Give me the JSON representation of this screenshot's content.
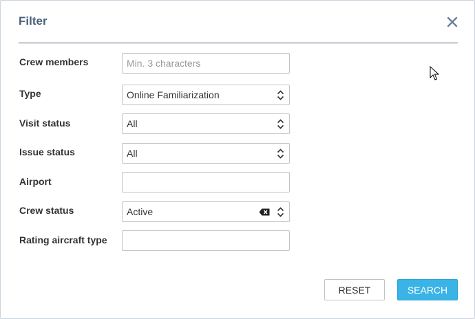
{
  "dialog": {
    "title": "Filter",
    "close_icon": "close-icon",
    "accent_color": "#4a5f78"
  },
  "fields": {
    "crew_members": {
      "label": "Crew members",
      "placeholder": "Min. 3 characters",
      "value": ""
    },
    "type": {
      "label": "Type",
      "value": "Online Familiarization"
    },
    "visit_status": {
      "label": "Visit status",
      "value": "All"
    },
    "issue_status": {
      "label": "Issue status",
      "value": "All"
    },
    "airport": {
      "label": "Airport",
      "value": ""
    },
    "crew_status": {
      "label": "Crew status",
      "value": "Active"
    },
    "rating_aircraft_type": {
      "label": "Rating aircraft type",
      "value": ""
    }
  },
  "buttons": {
    "reset_label": "RESET",
    "search_label": "SEARCH",
    "search_color": "#3ab3e6"
  }
}
